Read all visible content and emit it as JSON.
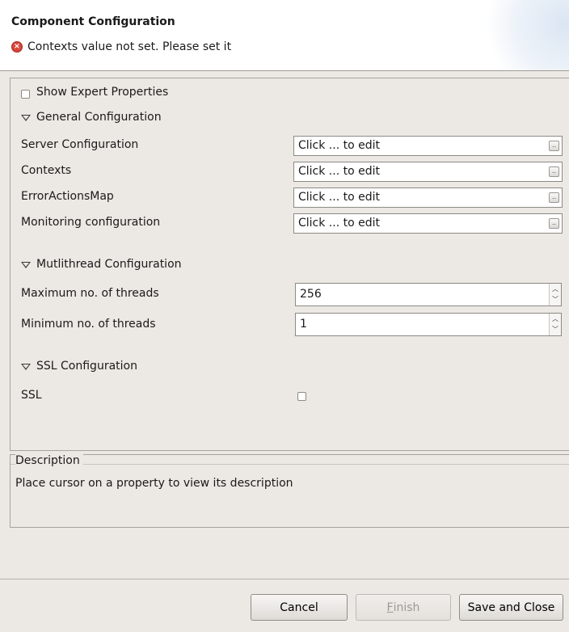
{
  "header": {
    "title": "Component Configuration",
    "error_message": "Contexts value not set. Please set it"
  },
  "options": {
    "show_expert_label": "Show Expert Properties"
  },
  "sections": {
    "general": {
      "title": "General Configuration",
      "rows": [
        {
          "label": "Server Configuration",
          "value": "Click ... to edit"
        },
        {
          "label": "Contexts",
          "value": "Click ... to edit"
        },
        {
          "label": "ErrorActionsMap",
          "value": "Click ... to edit"
        },
        {
          "label": "Monitoring configuration",
          "value": "Click ... to edit"
        }
      ]
    },
    "multithread": {
      "title": "Mutlithread Configuration",
      "rows": [
        {
          "label": "Maximum no. of threads",
          "value": "256"
        },
        {
          "label": "Minimum no. of threads",
          "value": "1"
        }
      ]
    },
    "ssl": {
      "title": "SSL Configuration",
      "label": "SSL"
    }
  },
  "description": {
    "title": "Description",
    "text": "Place cursor on a property to view its description"
  },
  "buttons": {
    "cancel": "Cancel",
    "finish_first": "F",
    "finish_rest": "inish",
    "save_close": "Save and Close"
  },
  "icons": {
    "error": "error-circle-icon",
    "expand": "triangle-down-icon",
    "ellipsis": "ellipsis-icon",
    "spin_up": "chevron-up-icon",
    "spin_down": "chevron-down-icon"
  }
}
